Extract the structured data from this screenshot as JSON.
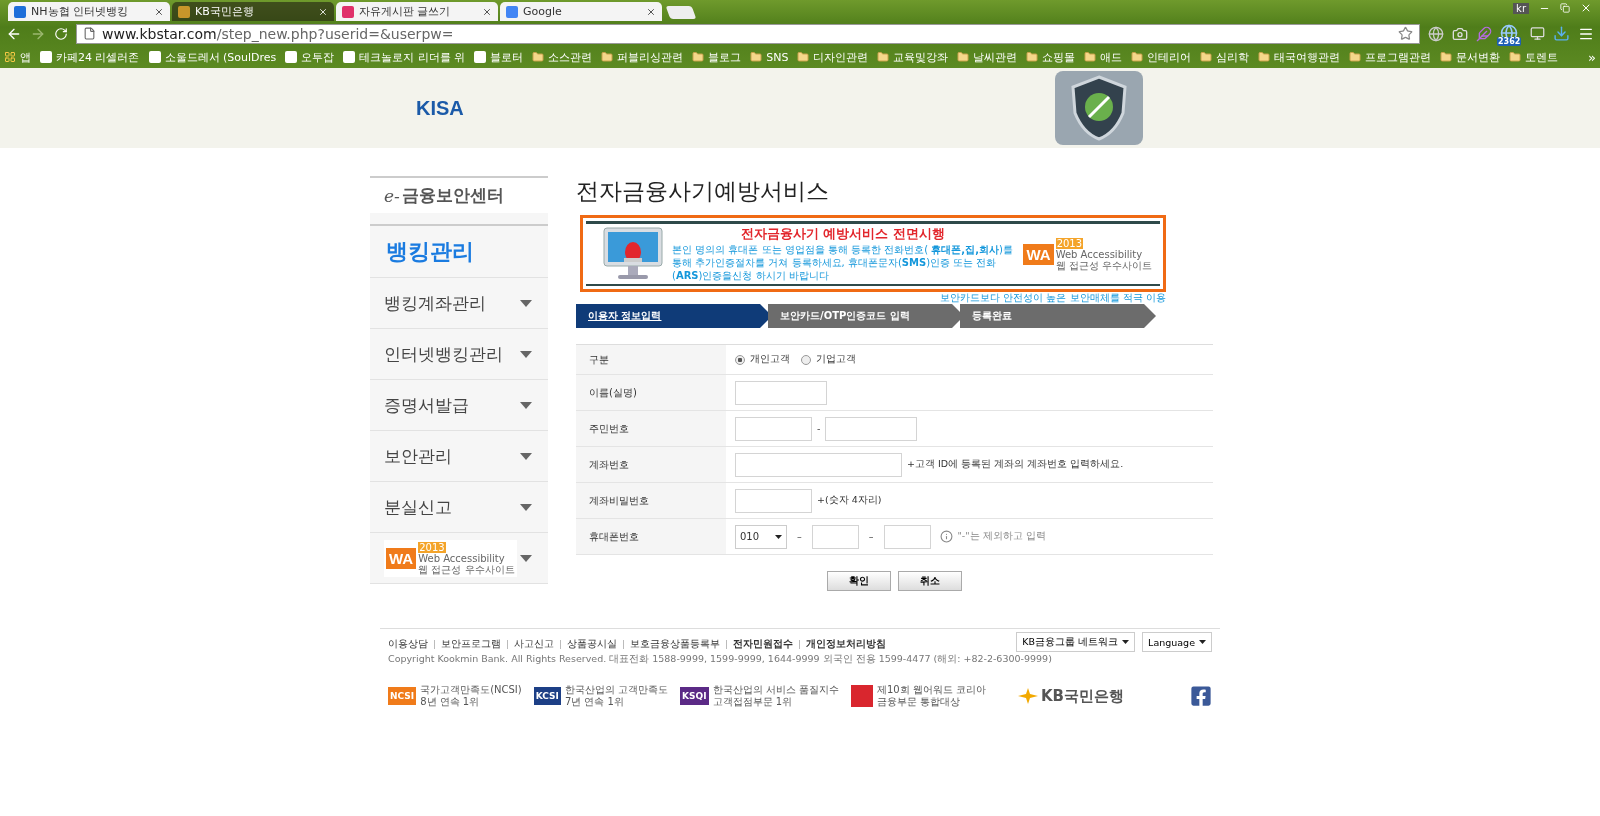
{
  "browser": {
    "tabs": [
      {
        "title": "NH농협 인터넷뱅킹",
        "selected": false,
        "color": "#1e6fd9"
      },
      {
        "title": "KB국민은행",
        "selected": true,
        "color": "#c8962a"
      },
      {
        "title": "자유게시판 글쓰기",
        "selected": false,
        "color": "#e0306a"
      },
      {
        "title": "Google",
        "selected": false,
        "color": "#4285f4"
      }
    ],
    "profile": "kr",
    "address": {
      "host": "www.kbstar.com",
      "path": "/step_new.php?userid=&userpw="
    },
    "extension_badge": "2362",
    "bookmarks": [
      {
        "label": "앱",
        "kind": "apps"
      },
      {
        "label": "카페24 리셀러존",
        "kind": "site"
      },
      {
        "label": "소울드레서 (SoulDres",
        "kind": "site"
      },
      {
        "label": "오투잡",
        "kind": "site"
      },
      {
        "label": "테크놀로지 리더를 위",
        "kind": "site"
      },
      {
        "label": "블로터",
        "kind": "site"
      },
      {
        "label": "소스관련",
        "kind": "folder"
      },
      {
        "label": "퍼블리싱관련",
        "kind": "folder"
      },
      {
        "label": "블로그",
        "kind": "folder"
      },
      {
        "label": "SNS",
        "kind": "folder"
      },
      {
        "label": "디자인관련",
        "kind": "folder"
      },
      {
        "label": "교육및강좌",
        "kind": "folder"
      },
      {
        "label": "날씨관련",
        "kind": "folder"
      },
      {
        "label": "쇼핑몰",
        "kind": "folder"
      },
      {
        "label": "애드",
        "kind": "folder"
      },
      {
        "label": "인테리어",
        "kind": "folder"
      },
      {
        "label": "심리학",
        "kind": "folder"
      },
      {
        "label": "태국여행관련",
        "kind": "folder"
      },
      {
        "label": "프로그램관련",
        "kind": "folder"
      },
      {
        "label": "문서변환",
        "kind": "folder"
      },
      {
        "label": "토렌트",
        "kind": "folder"
      }
    ],
    "more": "»"
  },
  "header": {
    "logo": "KISA"
  },
  "sidebar": {
    "title_prefix": "e-",
    "title": "금융보안센터",
    "heading": "뱅킹관리",
    "items": [
      {
        "label": "뱅킹계좌관리"
      },
      {
        "label": "인터넷뱅킹관리"
      },
      {
        "label": "증명서발급"
      },
      {
        "label": "보안관리"
      },
      {
        "label": "분실신고"
      }
    ],
    "badge": {
      "mark": "WA",
      "year": "2013",
      "caption": "Web Accessibility",
      "subcaption": "웹 접근성 우수사이트"
    }
  },
  "main": {
    "title": "전자금융사기예방서비스",
    "banner": {
      "headline": "전자금융사기 예방서비스 전면시행",
      "body": "본인 명의의 휴대폰 또는 영업점을 통해 등록한 전화번호( **휴대폰,집,회사**)를 통해 추가인증절차를 거쳐 등록하세요, 휴대폰문자(**SMS**)인증 또는 전화(**ARS**)인증을신청 하시기 바랍니다",
      "badge": {
        "mark": "WA",
        "year": "2013",
        "caption": "Web Accessibility",
        "subcaption": "웹 접근성 우수사이트"
      }
    },
    "notice": "보안카드보다 안전성이 높은 보안매체를 적극 이용",
    "steps": [
      {
        "label": "이용자 정보입력",
        "selected": true
      },
      {
        "label": "보안카드/OTP인증코드 입력",
        "selected": false
      },
      {
        "label": "등록완료",
        "selected": false
      }
    ],
    "form": [
      {
        "kind": "radio",
        "label": "구분",
        "options": [
          {
            "label": "개인고객",
            "selected": true
          },
          {
            "label": "기업고객",
            "selected": false
          }
        ]
      },
      {
        "kind": "name",
        "label": "이름(실명)"
      },
      {
        "kind": "ssn",
        "label": "주민번호",
        "separator": "-"
      },
      {
        "kind": "account",
        "label": "계좌번호",
        "hint": "+고객 ID에 등록된 계좌의 계좌번호 입력하세요."
      },
      {
        "kind": "pin",
        "label": "계좌비밀번호",
        "hint": "+(숫자 4자리)"
      },
      {
        "kind": "phone",
        "label": "휴대폰번호",
        "prefix": "010",
        "separator": "–",
        "hint": "\"-\"는 제외하고 입력"
      }
    ],
    "buttons": [
      "확인",
      "취소"
    ]
  },
  "footer": {
    "links": [
      {
        "label": "이용상담",
        "bold": false
      },
      {
        "label": "보안프로그램",
        "bold": false
      },
      {
        "label": "사고신고",
        "bold": false
      },
      {
        "label": "상품공시실",
        "bold": false
      },
      {
        "label": "보호금융상품등록부",
        "bold": false
      },
      {
        "label": "전자민원접수",
        "bold": true
      },
      {
        "label": "개인정보처리방침",
        "bold": true
      }
    ],
    "dropdowns": [
      "KB금융그룹 네트워크",
      "Language"
    ],
    "copyright": "Copyright Kookmin Bank. All Rights Reserved.  대표전화 1588-9999, 1599-9999, 1644-9999  외국인 전용 1599-4477 (해외: +82-2-6300-9999)",
    "awards": [
      {
        "mark": "NCSI",
        "color": "#f07b1a",
        "lines": [
          "국가고객만족도(NCSI)",
          "8년 연속 1위"
        ]
      },
      {
        "mark": "KCSI",
        "color": "#1d3f86",
        "lines": [
          "한국산업의 고객만족도",
          "7년 연속 1위"
        ]
      },
      {
        "mark": "KSQI",
        "color": "#5b2a86",
        "lines": [
          "한국산업의 서비스 품질지수",
          "고객접점부문 1위"
        ]
      },
      {
        "color": "#d9262e",
        "lines": [
          "제10회 웹어워드 코리아",
          "금융부문 통합대상"
        ]
      }
    ],
    "brand": "KB국민은행"
  }
}
